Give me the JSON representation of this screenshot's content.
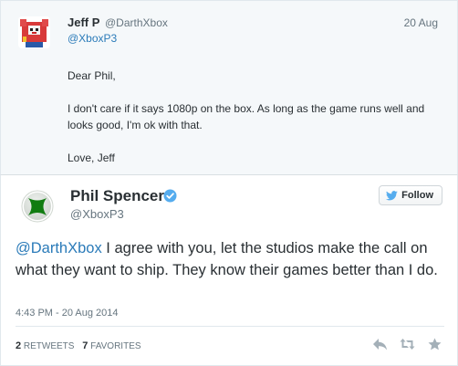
{
  "parent_tweet": {
    "author_name": "Jeff P",
    "author_handle": "@DarthXbox",
    "date": "20 Aug",
    "reply_to": "@XboxP3",
    "body_lines": [
      "Dear Phil,",
      "I don't care if it says 1080p on the box. As long as the game runs well and looks good, I'm ok with that.",
      "Love, Jeff"
    ]
  },
  "main_tweet": {
    "author_name": "Phil Spencer",
    "author_handle": "@XboxP3",
    "follow_label": "Follow",
    "mention": "@DarthXbox",
    "text": " I agree with you, let the studios make the call on what they want to ship.  They know their games better than I do.",
    "timestamp": "4:43 PM - 20 Aug 2014",
    "retweets_count": "2",
    "retweets_label": "RETWEETS",
    "favorites_count": "7",
    "favorites_label": "FAVORITES"
  },
  "colors": {
    "link": "#2b7bb9",
    "secondary_text": "#66757f",
    "verified": "#55acee",
    "xbox_green": "#107c10"
  },
  "icons": {
    "verified": "verified-badge-icon",
    "follow": "twitter-bird-icon",
    "reply": "reply-icon",
    "retweet": "retweet-icon",
    "favorite": "star-icon"
  }
}
